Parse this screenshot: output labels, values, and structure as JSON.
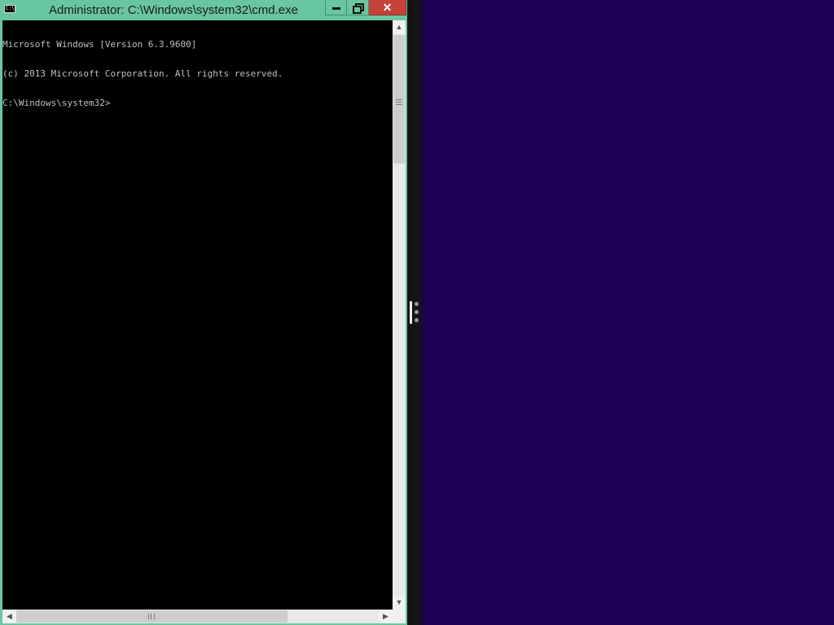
{
  "window": {
    "title": "Administrator: C:\\Windows\\system32\\cmd.exe",
    "icon_text": "C:\\",
    "buttons": {
      "minimize_icon": "minimize-icon",
      "restore_icon": "restore-icon",
      "close_symbol": "✕"
    }
  },
  "console": {
    "lines": [
      "Microsoft Windows [Version 6.3.9600]",
      "(c) 2013 Microsoft Corporation. All rights reserved.",
      "C:\\Windows\\system32>"
    ],
    "text_color": "#c0c0c0",
    "background": "#000000"
  },
  "scrollbars": {
    "up_arrow": "▲",
    "down_arrow": "▼",
    "left_arrow": "◀",
    "right_arrow": "▶"
  },
  "colors": {
    "titlebar": "#68c7a0",
    "close_button": "#c7403a",
    "desktop": "#1c0052"
  }
}
